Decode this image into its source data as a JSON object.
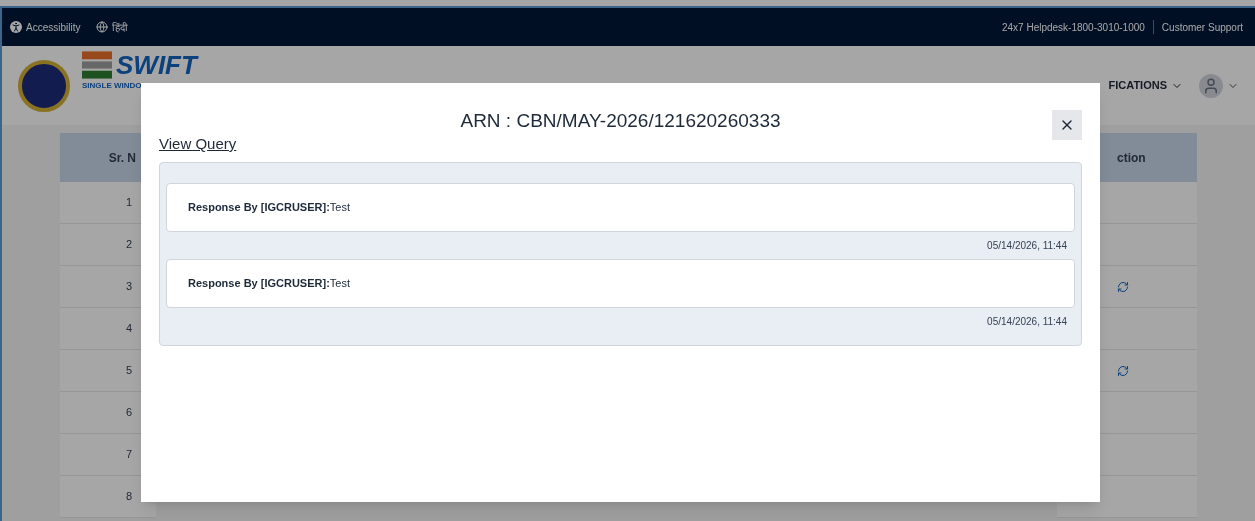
{
  "top_bar": {
    "accessibility": "Accessibility",
    "language": "हिंदी",
    "helpdesk": "24x7 Helpdesk-1800-3010-1000",
    "support": "Customer Support"
  },
  "header": {
    "logo_text": "SWIFT",
    "logo_subtitle": "SINGLE WINDO",
    "nav_item": "FICATIONS"
  },
  "table": {
    "columns": [
      "Sr. N",
      "ction"
    ],
    "rows": [
      {
        "sr": "1",
        "action_icon": false
      },
      {
        "sr": "2",
        "action_icon": false
      },
      {
        "sr": "3",
        "action_icon": true
      },
      {
        "sr": "4",
        "action_icon": false
      },
      {
        "sr": "5",
        "action_icon": true
      },
      {
        "sr": "6",
        "action_icon": false
      },
      {
        "sr": "7",
        "action_icon": false
      },
      {
        "sr": "8",
        "action_icon": false
      }
    ]
  },
  "modal": {
    "title": "ARN : CBN/MAY-2026/121620260333",
    "section_title": "View Query",
    "responses": [
      {
        "text": "**Response By [IGCRUSER]:**Test",
        "timestamp": "05/14/2026, 11:44"
      },
      {
        "text": "**Response By [IGCRUSER]:**Test",
        "timestamp": "05/14/2026, 11:44"
      }
    ]
  }
}
